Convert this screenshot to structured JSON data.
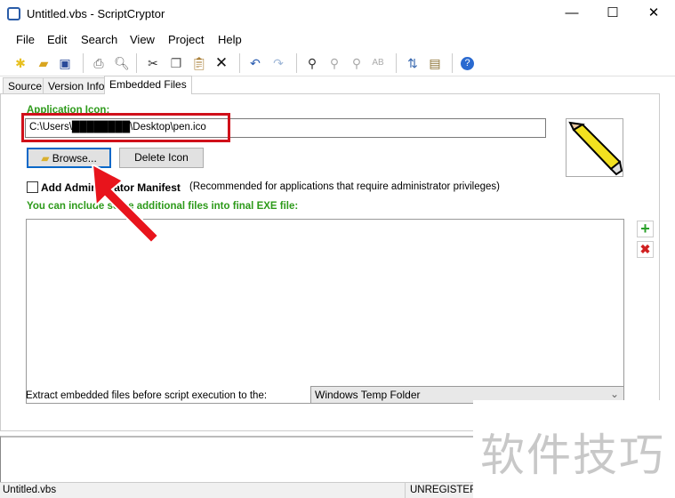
{
  "window": {
    "title": "Untitled.vbs - ScriptCryptor",
    "minimize": "—",
    "maximize": "☐",
    "close": "✕"
  },
  "menu": [
    "File",
    "Edit",
    "Search",
    "View",
    "Project",
    "Help"
  ],
  "tabs": [
    "Source",
    "Version Info",
    "Embedded Files"
  ],
  "content": {
    "app_icon_label": "Application Icon:",
    "app_icon_path": "C:\\Users\\████████\\Desktop\\pen.ico",
    "browse_label": "Browse...",
    "delete_icon_label": "Delete Icon",
    "admin_manifest_label": "Add Administrator Manifest",
    "admin_manifest_note": "(Recommended for applications that require administrator privileges)",
    "include_files_label": "You can include some additional files into final EXE file:",
    "extract_label": "Extract embedded files before script execution to the:",
    "extract_location": "Windows Temp Folder"
  },
  "status": {
    "file": "Untitled.vbs",
    "registration": "UNREGISTERED"
  },
  "watermark": "软件技巧"
}
